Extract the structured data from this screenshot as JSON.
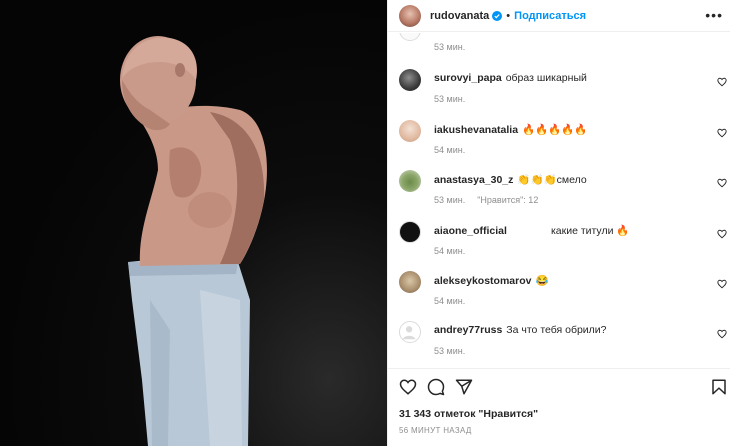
{
  "header": {
    "username": "rudovanata",
    "separator": "•",
    "follow_label": "Подписаться",
    "more_label": "•••"
  },
  "top_comment": {
    "time": "53 мин."
  },
  "comments": [
    {
      "user": "surovyi_papa",
      "text": "образ шикарный",
      "time": "53 мин.",
      "likes": ""
    },
    {
      "user": "iakushevanatalia",
      "text": "🔥🔥🔥🔥🔥",
      "time": "54 мин.",
      "likes": ""
    },
    {
      "user": "anastasya_30_z",
      "text": "👏👏👏смело",
      "time": "53 мин.",
      "likes": "\"Нравится\": 12"
    },
    {
      "user": "aiaone_official",
      "text": "какие титули 🔥",
      "time": "54 мин.",
      "likes": ""
    },
    {
      "user": "alekseykostomarov",
      "text": "😂",
      "time": "54 мин.",
      "likes": ""
    },
    {
      "user": "andrey77russ",
      "text": "За что тебя обрили?",
      "time": "53 мин.",
      "likes": ""
    }
  ],
  "actions": {
    "like_icon": "heart-icon",
    "comment_icon": "comment-icon",
    "share_icon": "share-icon",
    "save_icon": "bookmark-icon"
  },
  "likes_text": "31 343 отметок \"Нравится\"",
  "posted_time": "56 МИНУТ НАЗАД",
  "colors": {
    "accent": "#0095f6",
    "muted": "#8e8e8e",
    "text": "#262626"
  }
}
